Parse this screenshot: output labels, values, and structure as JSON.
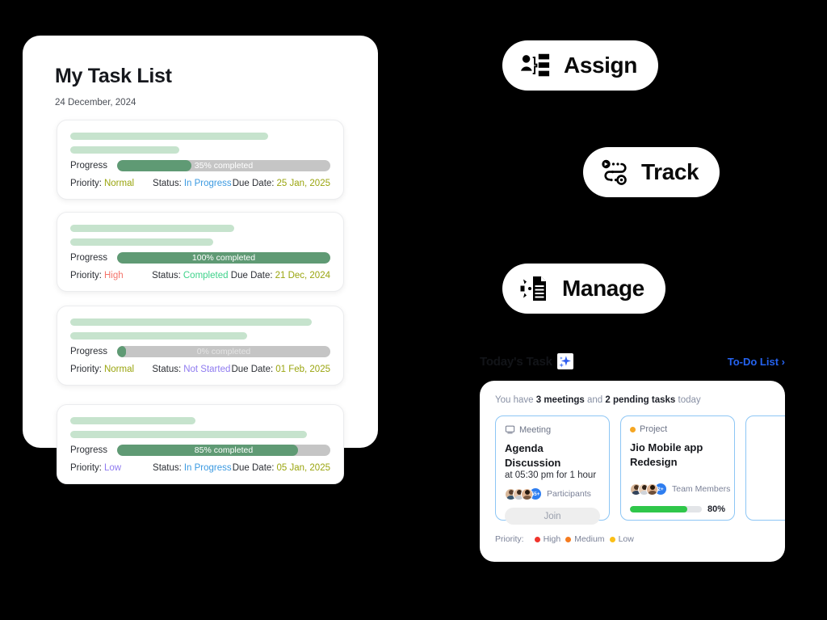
{
  "task_panel": {
    "title": "My Task List",
    "date": "24 December, 2024",
    "labels": {
      "progress": "Progress",
      "priority": "Priority:",
      "status": "Status:",
      "due_date": "Due Date:"
    },
    "tasks": [
      {
        "progress_text": "35% completed",
        "progress_pct": 35,
        "priority": "Normal",
        "priority_color": "#9aa50f",
        "status": "In Progress",
        "status_color": "#3b9ae1",
        "due_date": "25 Jan, 2025",
        "due_color": "#9aa50f",
        "skeleton_widths": [
          "76%",
          "42%"
        ]
      },
      {
        "progress_text": "100% completed",
        "progress_pct": 100,
        "priority": "High",
        "priority_color": "#f4746a",
        "status": "Completed",
        "status_color": "#3ed28a",
        "due_date": "21 Dec, 2024",
        "due_color": "#9aa50f",
        "skeleton_widths": [
          "63%",
          "55%"
        ]
      },
      {
        "progress_text": "0% completed",
        "progress_pct": 4,
        "priority": "Normal",
        "priority_color": "#9aa50f",
        "status": "Not Started",
        "status_color": "#8f7bf0",
        "due_date": "01 Feb, 2025",
        "due_color": "#9aa50f",
        "skeleton_widths": [
          "93%",
          "68%"
        ]
      },
      {
        "progress_text": "85% completed",
        "progress_pct": 85,
        "priority": "Low",
        "priority_color": "#8f7bf0",
        "status": "In Progress",
        "status_color": "#3b9ae1",
        "due_date": "05 Jan, 2025",
        "due_color": "#9aa50f",
        "skeleton_widths": [
          "48%",
          "91%"
        ]
      }
    ]
  },
  "action_pills": [
    {
      "label": "Assign",
      "icon": "assign-person-list-icon"
    },
    {
      "label": "Track",
      "icon": "route-track-icon"
    },
    {
      "label": "Manage",
      "icon": "gear-document-icon"
    }
  ],
  "today": {
    "header_title": "Today's Task",
    "sparkle_icon": "sparkle-icon",
    "link_label": "To-Do List ›",
    "summary": {
      "pre": "You have ",
      "count_meetings": "3 meetings",
      "mid": " and ",
      "count_tasks": "2 pending tasks",
      "post": " today"
    },
    "cards": [
      {
        "kind": "Meeting",
        "kind_icon": "monitor-icon",
        "kind_dot_color": "",
        "title": "Agenda Discussion",
        "subtitle": "at 05:30 pm for 1 hour",
        "avatar_badge": "55+",
        "avatar_label": "Participants",
        "button_label": "Join"
      },
      {
        "kind": "Project",
        "kind_icon": "dot-icon",
        "kind_dot_color": "#f5a623",
        "title": "Jio Mobile app Redesign",
        "subtitle": "",
        "avatar_badge": "2+",
        "avatar_label": "Team Members",
        "progress_pct": 80,
        "progress_label": "80%"
      }
    ],
    "legend": {
      "label": "Priority:",
      "items": [
        {
          "label": "High",
          "color": "#f0342c"
        },
        {
          "label": "Medium",
          "color": "#f57b1f"
        },
        {
          "label": "Low",
          "color": "#fbbf17"
        }
      ]
    }
  },
  "colors": {
    "background": "#000000",
    "panel": "#ffffff",
    "progress_fill": "#5f9a74",
    "progress_track": "#c5c5c5",
    "skeleton": "#c6e3cd",
    "accent_blue": "#2563f0",
    "card_border_blue": "#8dc6f5",
    "green_bar": "#2fc74a"
  }
}
